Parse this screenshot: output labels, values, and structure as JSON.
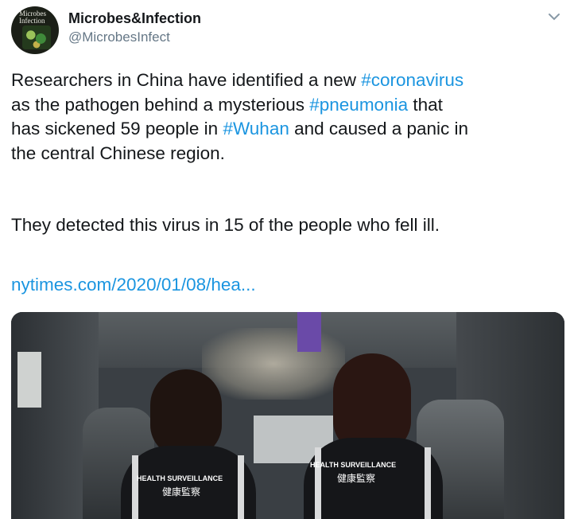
{
  "author": {
    "display_name": "Microbes&Infection",
    "handle": "@MicrobesInfect",
    "avatar_text": [
      "Microbes",
      "Infection"
    ]
  },
  "tweet": {
    "line1_a": "Researchers in China have identified a new ",
    "tag_coronavirus": "#coronavirus",
    "line2_a": "as the pathogen behind a mysterious ",
    "tag_pneumonia": "#pneumonia",
    "line2_b": " that",
    "line3_a": "has sickened 59 people in ",
    "tag_wuhan": "#Wuhan",
    "line3_b": " and caused a panic in",
    "line4": "the central Chinese region.",
    "para2": "They detected this virus in 15 of the people who fell ill.",
    "link": "nytimes.com/2020/01/08/hea..."
  },
  "media": {
    "jacket_left_en": "HEALTH SURVEILLANCE",
    "jacket_left_zh": "健康監察",
    "jacket_right_en": "HEALTH SURVEILLANCE",
    "jacket_right_zh": "健康監察"
  },
  "colors": {
    "link": "#1b95e0",
    "text": "#14171a",
    "secondary": "#657786"
  },
  "icons": {
    "menu": "chevron-down-icon"
  }
}
